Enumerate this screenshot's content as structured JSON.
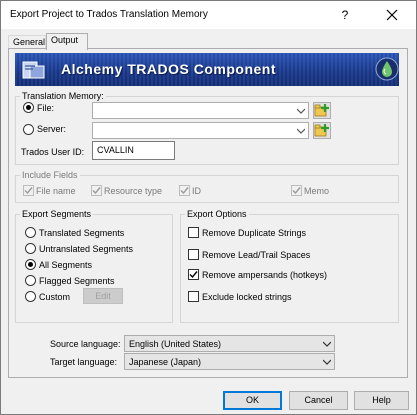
{
  "window": {
    "title": "Export Project to Trados Translation Memory",
    "help_glyph": "?",
    "close_glyph": "✕"
  },
  "tabs": [
    {
      "label": "General",
      "active": false
    },
    {
      "label": "Output",
      "active": true
    }
  ],
  "banner": {
    "text": "Alchemy TRADOS Component"
  },
  "translation_memory": {
    "legend": "Translation Memory:",
    "file_label": "File:",
    "file_selected": true,
    "file_value": "",
    "server_label": "Server:",
    "server_selected": false,
    "server_value": "",
    "user_id_label": "Trados User ID:",
    "user_id_value": "CVALLIN"
  },
  "include_fields": {
    "legend": "Include Fields",
    "items": [
      {
        "label": "File name",
        "checked": true
      },
      {
        "label": "Resource type",
        "checked": true
      },
      {
        "label": "ID",
        "checked": true
      },
      {
        "label": "Memo",
        "checked": true
      }
    ]
  },
  "export_segments": {
    "legend": "Export Segments",
    "options": [
      {
        "label": "Translated Segments",
        "selected": false
      },
      {
        "label": "Untranslated Segments",
        "selected": false
      },
      {
        "label": "All Segments",
        "selected": true
      },
      {
        "label": "Flagged Segments",
        "selected": false
      },
      {
        "label": "Custom",
        "selected": false
      }
    ],
    "edit_label": "Edit"
  },
  "export_options": {
    "legend": "Export Options",
    "items": [
      {
        "label": "Remove Duplicate Strings",
        "checked": false
      },
      {
        "label": "Remove Lead/Trail Spaces",
        "checked": false
      },
      {
        "label": "Remove ampersands (hotkeys)",
        "checked": true
      },
      {
        "label": "Exclude locked strings",
        "checked": false
      }
    ]
  },
  "languages": {
    "source_label": "Source language:",
    "source_value": "English (United States)",
    "target_label": "Target language:",
    "target_value": "Japanese (Japan)"
  },
  "buttons": {
    "ok": "OK",
    "cancel": "Cancel",
    "help": "Help"
  },
  "colors": {
    "banner_blue": "#1e3c8a",
    "focus_blue": "#0078d7",
    "panel_gray": "#f0f0f0"
  }
}
